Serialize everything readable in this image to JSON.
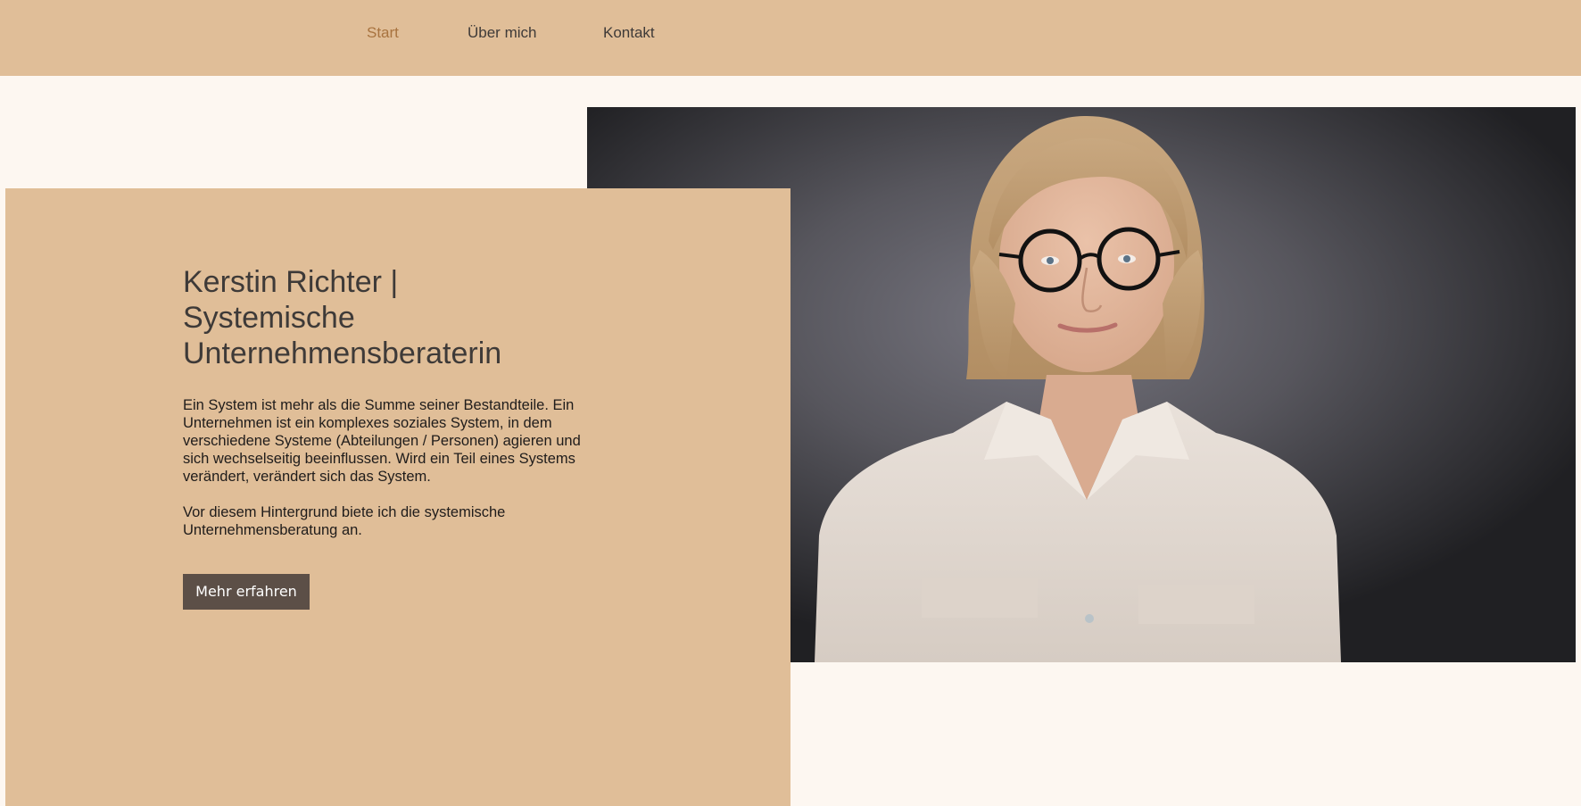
{
  "nav": {
    "items": [
      {
        "label": "Start",
        "active": true
      },
      {
        "label": "Über mich",
        "active": false
      },
      {
        "label": "Kontakt",
        "active": false
      }
    ]
  },
  "hero": {
    "headline_lines": [
      "Kerstin Richter |",
      "Systemische",
      "Unternehmensberaterin"
    ],
    "paragraph_1_lines": [
      "Ein System ist mehr als die Summe seiner Bestandteile. Ein",
      "Unternehmen ist ein komplexes soziales System, in dem",
      "verschiedene Systeme (Abteilungen / Personen) agieren und",
      "sich wechselseitig beeinflussen. Wird ein Teil eines Systems",
      "verändert, verändert sich das System."
    ],
    "paragraph_2_lines": [
      "Vor diesem Hintergrund biete ich die systemische",
      "Unternehmensberatung an."
    ],
    "cta_label": "Mehr erfahren"
  },
  "colors": {
    "header_bg": "#E0BE98",
    "page_bg": "#FDF7F1",
    "panel_bg": "#E0BE98",
    "nav_active": "#A8733F",
    "text_dark": "#3E3A38",
    "button_bg": "#5C4F47"
  }
}
